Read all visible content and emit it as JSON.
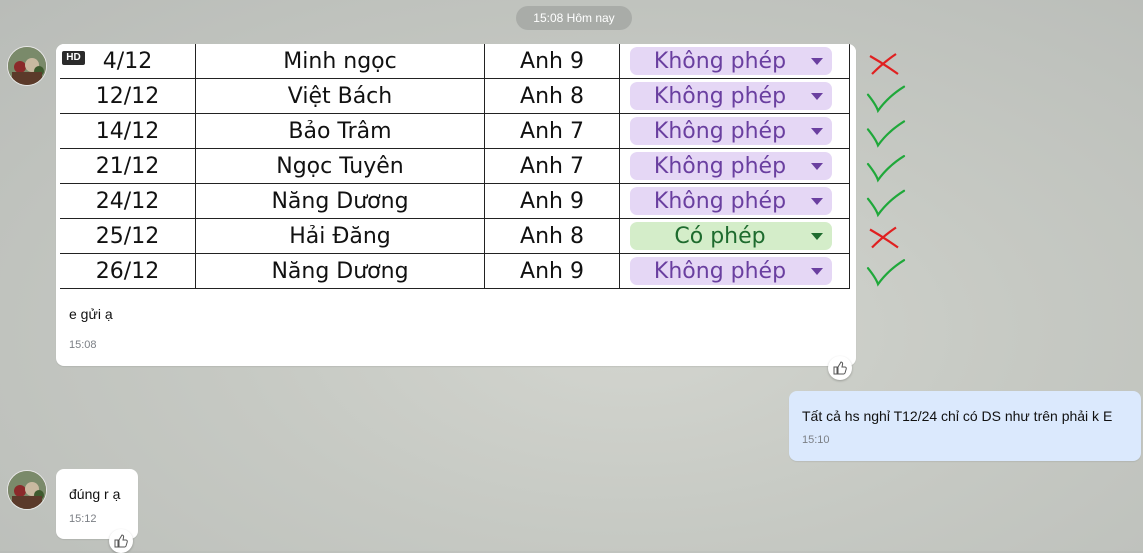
{
  "date_separator": "15:08 Hôm nay",
  "photo": {
    "badge": "HD",
    "rows": [
      {
        "date": "4/12",
        "name": "Minh ngọc",
        "class": "Anh 9",
        "status": "Không phép",
        "status_color": "#6a3fa0",
        "status_bg": "#e5d7f5",
        "mark": "cross"
      },
      {
        "date": "12/12",
        "name": "Việt Bách",
        "class": "Anh 8",
        "status": "Không phép",
        "status_color": "#6a3fa0",
        "status_bg": "#e5d7f5",
        "mark": "check"
      },
      {
        "date": "14/12",
        "name": "Bảo Trâm",
        "class": "Anh 7",
        "status": "Không phép",
        "status_color": "#6a3fa0",
        "status_bg": "#e5d7f5",
        "mark": "check"
      },
      {
        "date": "21/12",
        "name": "Ngọc Tuyên",
        "class": "Anh 7",
        "status": "Không phép",
        "status_color": "#6a3fa0",
        "status_bg": "#e5d7f5",
        "mark": "check"
      },
      {
        "date": "24/12",
        "name": "Năng Dương",
        "class": "Anh 9",
        "status": "Không phép",
        "status_color": "#6a3fa0",
        "status_bg": "#e5d7f5",
        "mark": "check"
      },
      {
        "date": "25/12",
        "name": "Hải Đăng",
        "class": "Anh 8",
        "status": "Có phép",
        "status_color": "#1e6b2e",
        "status_bg": "#d4edc9",
        "mark": "cross"
      },
      {
        "date": "26/12",
        "name": "Năng Dương",
        "class": "Anh 9",
        "status": "Không phép",
        "status_color": "#6a3fa0",
        "status_bg": "#e5d7f5",
        "mark": "check"
      }
    ]
  },
  "messages": {
    "msg1": {
      "text": "e gửi ạ",
      "time": "15:08"
    },
    "msg2": {
      "text": "Tất cả hs nghỉ T12/24 chỉ có DS như trên phải k E",
      "time": "15:10"
    },
    "msg3": {
      "text": "đúng r ạ",
      "time": "15:12"
    }
  },
  "icons": {
    "reaction": "thumbs-up-icon",
    "avatar": "group-avatar"
  },
  "colors": {
    "outgoing_bubble": "#dbe9fd",
    "check_mark": "#1fa83a",
    "cross_mark": "#e02020"
  }
}
